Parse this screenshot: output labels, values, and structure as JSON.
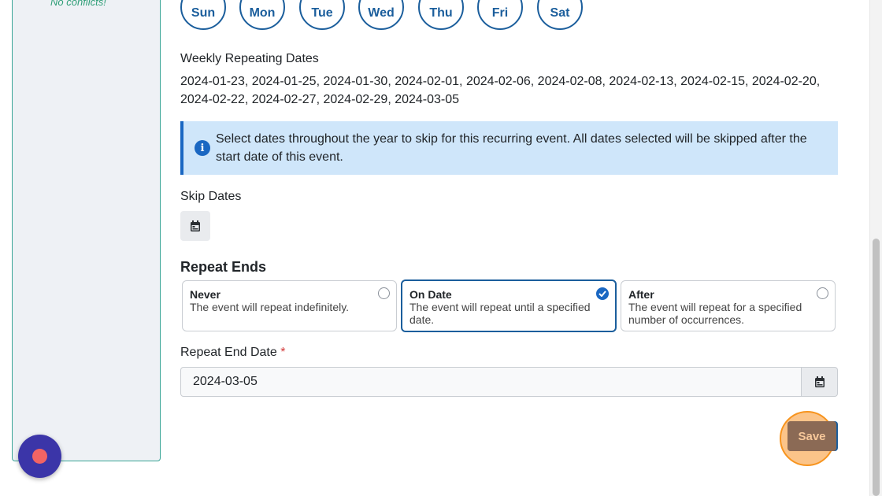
{
  "sidebar": {
    "conflict_note": "No conflicts!"
  },
  "days": [
    "Sun",
    "Mon",
    "Tue",
    "Wed",
    "Thu",
    "Fri",
    "Sat"
  ],
  "weekly": {
    "label": "Weekly Repeating Dates",
    "dates": "2024-01-23, 2024-01-25, 2024-01-30, 2024-02-01, 2024-02-06, 2024-02-08, 2024-02-13, 2024-02-15, 2024-02-20, 2024-02-22, 2024-02-27, 2024-02-29, 2024-03-05"
  },
  "info": {
    "icon": "info-icon",
    "text": "Select dates throughout the year to skip for this recurring event. All dates selected will be skipped after the start date of this event."
  },
  "skip": {
    "label": "Skip Dates",
    "icon": "calendar-icon"
  },
  "repeat_ends": {
    "title": "Repeat Ends",
    "options": [
      {
        "title": "Never",
        "description": "The event will repeat indefinitely.",
        "selected": false
      },
      {
        "title": "On Date",
        "description": "The event will repeat until a specified date.",
        "selected": true
      },
      {
        "title": "After",
        "description": "The event will repeat for a specified number of occurrences.",
        "selected": false
      }
    ]
  },
  "end_date": {
    "label": "Repeat End Date",
    "required_mark": "*",
    "value": "2024-03-05",
    "icon": "calendar-icon"
  },
  "actions": {
    "save_label": "Save"
  },
  "colors": {
    "primary": "#1b5e9c",
    "info_bg": "#cfe6fa",
    "highlight": "#f7941e",
    "fab": "#3b35a8",
    "success_text": "#2f9e77"
  }
}
